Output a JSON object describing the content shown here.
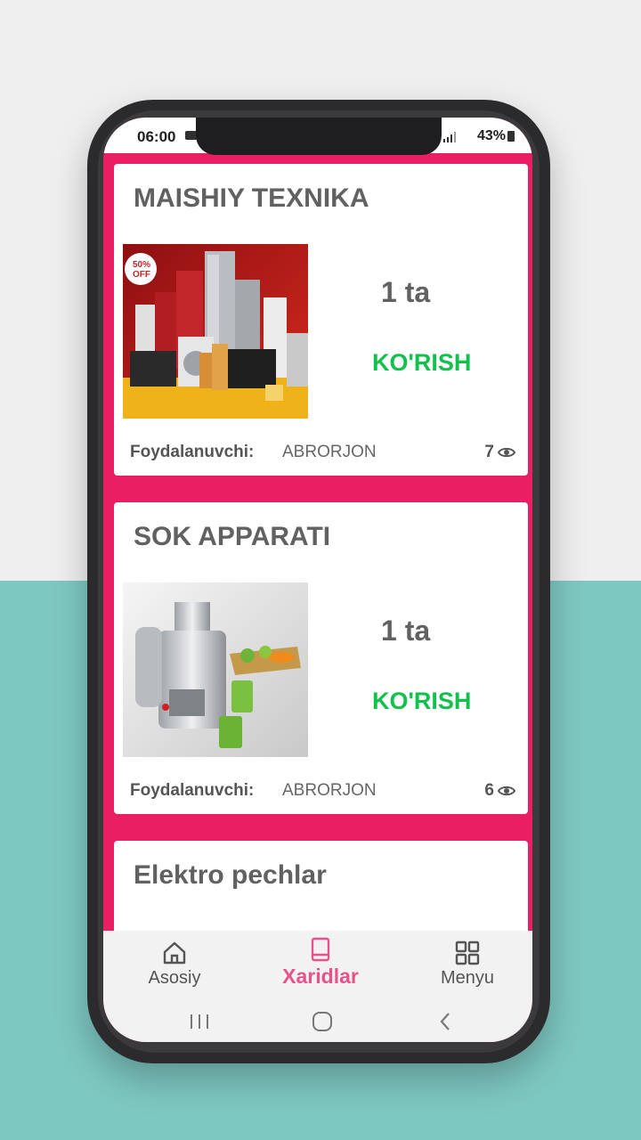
{
  "status_bar": {
    "time": "06:00",
    "battery": "43%"
  },
  "cards": [
    {
      "title": "MAISHIY TEXNIKA",
      "count": "1 ta",
      "action": "KO'RISH",
      "user_label": "Foydalanuvchi:",
      "user_name": "ABRORJON",
      "views": "7",
      "image": "home-appliances-sale-image",
      "badge": "50% OFF"
    },
    {
      "title": "SOK APPARATI",
      "count": "1 ta",
      "action": "KO'RISH",
      "user_label": "Foydalanuvchi:",
      "user_name": "ABRORJON",
      "views": "6",
      "image": "juicer-image"
    },
    {
      "title": "Elektro pechlar"
    }
  ],
  "bottom_nav": [
    {
      "label": "Asosiy",
      "icon": "home-icon",
      "active": false
    },
    {
      "label": "Xaridlar",
      "icon": "book-icon",
      "active": true
    },
    {
      "label": "Menyu",
      "icon": "grid-icon",
      "active": false
    }
  ],
  "colors": {
    "accent": "#e91e63",
    "action_green": "#12c04c",
    "active_tab": "#e8528a",
    "teal_background": "#7ec8c2"
  }
}
